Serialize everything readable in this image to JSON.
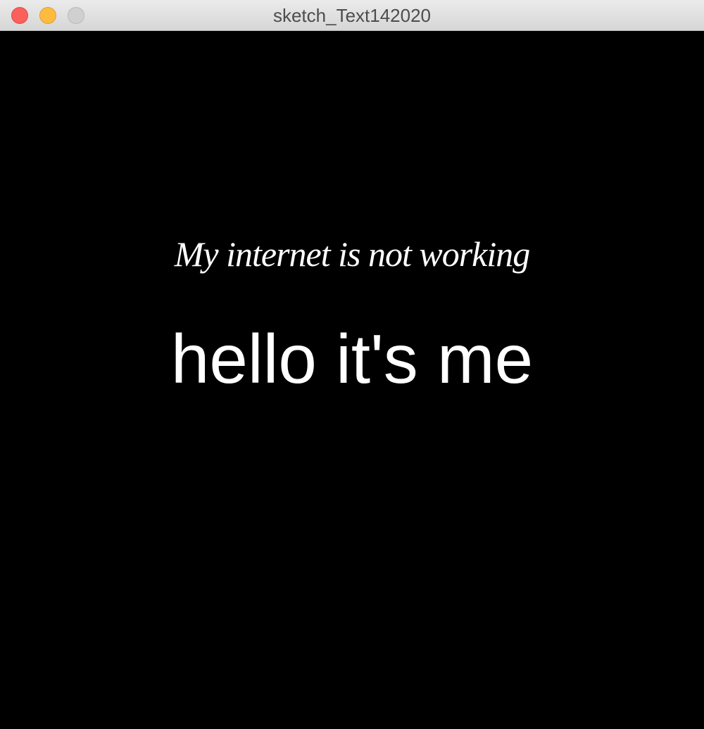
{
  "window": {
    "title": "sketch_Text142020",
    "controls": [
      {
        "name": "close",
        "color": "#fc605c"
      },
      {
        "name": "minimize",
        "color": "#fdbc40"
      },
      {
        "name": "zoom",
        "color": "#d0d0d0"
      }
    ]
  },
  "canvas": {
    "background": "#000000",
    "text_color": "#ffffff",
    "line1": "My internet is not working",
    "line2": "hello it's me"
  }
}
